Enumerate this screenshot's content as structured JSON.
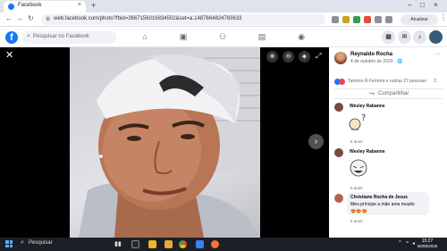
{
  "browser": {
    "tab_title": "Facebook",
    "tab_close": "×",
    "new_tab": "+",
    "url": "web.facebook.com/photo?fbid=2667156016834502&set=a.1487664824783633",
    "update_button": "Atualizar",
    "window_controls": [
      "–",
      "□",
      "×"
    ]
  },
  "facebook": {
    "logo": "f",
    "search_placeholder": "Pesquisar no Facebook",
    "nav_icons": [
      "home-icon",
      "watch-icon",
      "friends-icon",
      "marketplace-icon",
      "gaming-icon"
    ],
    "right_icons": [
      "menu-icon",
      "messenger-icon",
      "notifications-icon"
    ]
  },
  "viewer": {
    "close": "✕",
    "next": "›",
    "tools": [
      "zoom-in-icon",
      "zoom-out-icon",
      "tag-icon",
      "fullscreen-icon"
    ]
  },
  "post": {
    "author": "Reynaldo Rocha",
    "date": "4 de outubro de 2020 · 🌐",
    "reactions_text": "Tamires R Ferreira e outras 27 pessoas",
    "comment_count": "3",
    "share_label": "Compartilhar",
    "comments": [
      {
        "name": "Wesley Rabanne",
        "text": "",
        "time": "5 anos",
        "sticker": "question-sticker"
      },
      {
        "name": "Wesley Rabanne",
        "text": "",
        "time": "5 anos",
        "sticker": "laughing-sticker"
      },
      {
        "name": "Christiane Rocha de Jesus",
        "text": "Meu príncipe a mãe ama muuito",
        "emojis": "😍😍😍",
        "time": "5 anos"
      }
    ]
  },
  "taskbar": {
    "search_label": "Pesquisar",
    "time": "15:27",
    "date": "06/05/2026",
    "colors": {
      "accent": "#1877f2"
    }
  }
}
